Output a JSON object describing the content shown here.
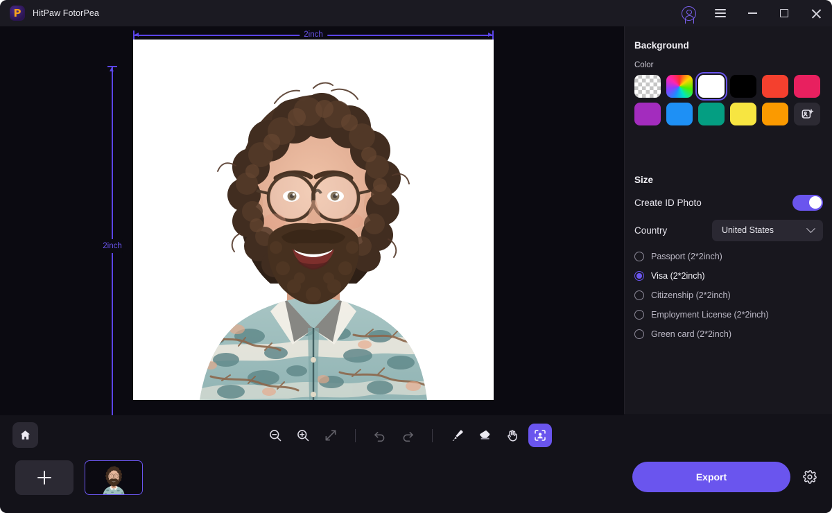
{
  "app": {
    "title": "HitPaw FotorPea",
    "logo_icon": "hitpaw-logo",
    "logo_letter": "P"
  },
  "titlebar": {
    "account_icon": "account-icon",
    "menu_icon": "hamburger-menu-icon",
    "minimize_icon": "minimize-icon",
    "maximize_icon": "maximize-icon",
    "close_icon": "close-icon"
  },
  "canvas": {
    "width_label": "2inch",
    "height_label": "2inch",
    "photo_alt": "portrait-photo-white-background"
  },
  "panel": {
    "background": {
      "title": "Background",
      "color_label": "Color",
      "swatches": [
        {
          "name": "transparent",
          "kind": "checker",
          "hex": "",
          "selected": false
        },
        {
          "name": "color-picker",
          "kind": "wheel",
          "hex": "",
          "selected": false
        },
        {
          "name": "white",
          "kind": "solid",
          "hex": "#FFFFFF",
          "selected": true
        },
        {
          "name": "black",
          "kind": "solid",
          "hex": "#000000",
          "selected": false
        },
        {
          "name": "red",
          "kind": "solid",
          "hex": "#F4402E",
          "selected": false
        },
        {
          "name": "pink",
          "kind": "solid",
          "hex": "#E8205F",
          "selected": false
        },
        {
          "name": "purple",
          "kind": "solid",
          "hex": "#A32CBE",
          "selected": false
        },
        {
          "name": "blue",
          "kind": "solid",
          "hex": "#1E90F5",
          "selected": false
        },
        {
          "name": "teal",
          "kind": "solid",
          "hex": "#049E82",
          "selected": false
        },
        {
          "name": "yellow",
          "kind": "solid",
          "hex": "#F7E541",
          "selected": false
        },
        {
          "name": "orange",
          "kind": "solid",
          "hex": "#FB9A00",
          "selected": false
        },
        {
          "name": "custom-image",
          "kind": "addimg",
          "hex": "",
          "selected": false
        }
      ]
    },
    "size": {
      "title": "Size",
      "id_photo_label": "Create ID Photo",
      "id_photo_enabled": true,
      "country_label": "Country",
      "country_value": "United States",
      "options": [
        {
          "label": "Passport (2*2inch)",
          "selected": false
        },
        {
          "label": "Visa (2*2inch)",
          "selected": true
        },
        {
          "label": "Citizenship (2*2inch)",
          "selected": false
        },
        {
          "label": "Employment License (2*2inch)",
          "selected": false
        },
        {
          "label": "Green card (2*2inch)",
          "selected": false
        }
      ]
    }
  },
  "toolbar": {
    "home_icon": "home-icon",
    "tools": [
      {
        "name": "zoom-out-icon",
        "enabled": true
      },
      {
        "name": "zoom-in-icon",
        "enabled": true
      },
      {
        "name": "fit-screen-icon",
        "enabled": false
      },
      {
        "name": "undo-icon",
        "enabled": false
      },
      {
        "name": "redo-icon",
        "enabled": false
      },
      {
        "name": "brush-icon",
        "enabled": true
      },
      {
        "name": "eraser-icon",
        "enabled": true
      },
      {
        "name": "hand-icon",
        "enabled": true
      },
      {
        "name": "id-photo-icon",
        "enabled": true,
        "active": true
      }
    ]
  },
  "filmstrip": {
    "add_icon": "plus-icon",
    "thumbnail_name": "portrait-thumbnail",
    "export_label": "Export",
    "settings_icon": "gear-icon"
  },
  "colors": {
    "accent": "#6A55EE",
    "panel_bg": "#18171E",
    "canvas_bg": "#0B0A11",
    "chrome_bg": "#131219",
    "titlebar_bg": "#1B1A22"
  }
}
